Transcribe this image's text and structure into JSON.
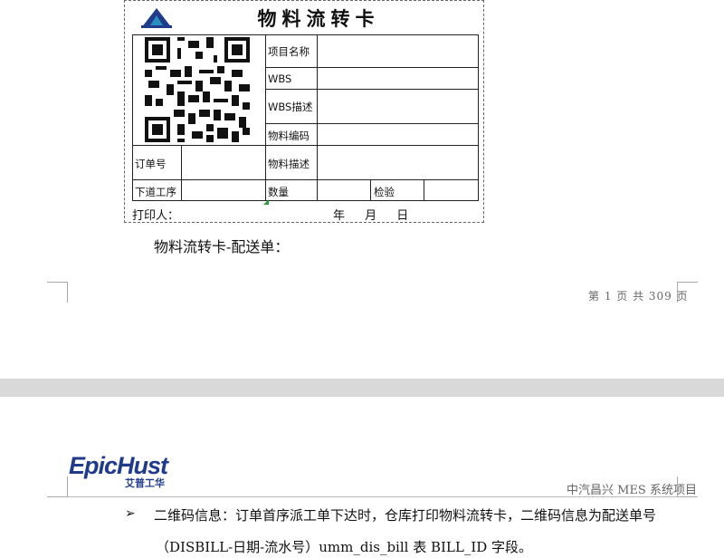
{
  "card": {
    "title": "物料流转卡",
    "labels": {
      "project_name": "项目名称",
      "wbs": "WBS",
      "wbs_desc": "WBS描述",
      "material_code": "物料编码",
      "order_no": "订单号",
      "material_desc": "物料描述",
      "next_process": "下道工序",
      "quantity": "数量",
      "inspection": "检验"
    },
    "printer_label": "打印人：",
    "date_label": "年  月  日"
  },
  "caption": "物料流转卡-配送单：",
  "footer": {
    "page_text": "第 1 页 共 309 页"
  },
  "page2": {
    "logo_text": "EpicHust",
    "logo_sub": "艾普工华",
    "header_right": "中汽昌兴 MES 系统项目",
    "bullet": "➢",
    "para_line1": "二维码信息：订单首序派工单下达时，仓库打印物料流转卡，二维码信息为配送单号",
    "para_line2": "（DISBILL-日期-流水号）umm_dis_bill 表 BILL_ID 字段。"
  },
  "colors": {
    "logo_blue": "#1f3b8a",
    "logo_teal": "#2a8fbf",
    "frame": "#222222"
  }
}
